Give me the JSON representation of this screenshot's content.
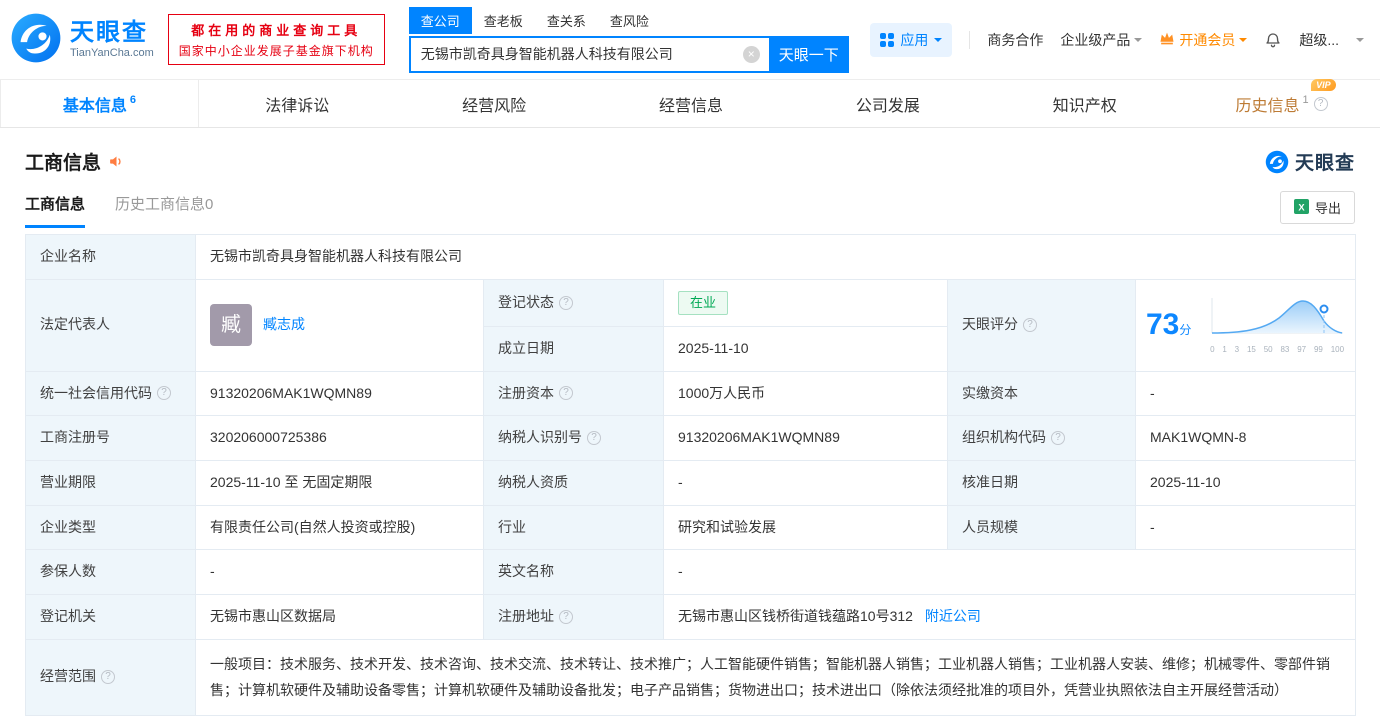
{
  "colors": {
    "brand_blue": "#0084ff",
    "promo_red": "#e60012",
    "status_green": "#00a854",
    "history_tab": "#bd7b35",
    "vip_orange": "#ff9a1f",
    "label_cell_bg": "#eef6fb"
  },
  "header": {
    "logo": {
      "name": "天眼查",
      "domain": "TianYanCha.com"
    },
    "promo": {
      "line1": "都在用的商业查询工具",
      "line2": "国家中小企业发展子基金旗下机构"
    },
    "search": {
      "tabs": [
        {
          "label": "查公司"
        },
        {
          "label": "查老板"
        },
        {
          "label": "查关系"
        },
        {
          "label": "查风险"
        }
      ],
      "value": "无锡市凯奇具身智能机器人科技有限公司",
      "button": "天眼一下"
    },
    "nav": {
      "app": "应用",
      "cooperation": "商务合作",
      "enterprise": "企业级产品",
      "member": "开通会员",
      "super": "超级..."
    }
  },
  "main_tabs": [
    {
      "label": "基本信息",
      "count": "6"
    },
    {
      "label": "法律诉讼"
    },
    {
      "label": "经营风险"
    },
    {
      "label": "经营信息"
    },
    {
      "label": "公司发展"
    },
    {
      "label": "知识产权"
    },
    {
      "label": "历史信息",
      "count": "1",
      "vip_label": "VIP"
    }
  ],
  "section": {
    "title": "工商信息",
    "brand": "天眼查",
    "tabs": [
      {
        "label": "工商信息"
      },
      {
        "label": "历史工商信息0"
      }
    ],
    "export": "导出"
  },
  "info": {
    "company_name": {
      "label": "企业名称",
      "value": "无锡市凯奇具身智能机器人科技有限公司"
    },
    "legal_rep": {
      "label": "法定代表人",
      "avatar": "臧",
      "name": "臧志成"
    },
    "reg_status": {
      "label": "登记状态",
      "value": "在业"
    },
    "est_date": {
      "label": "成立日期",
      "value": "2025-11-10"
    },
    "score": {
      "label": "天眼评分",
      "value": "73",
      "unit": "分",
      "axis": [
        "0",
        "1",
        "3",
        "15",
        "50",
        "83",
        "97",
        "99",
        "100"
      ]
    },
    "credit_code": {
      "label": "统一社会信用代码",
      "value": "91320206MAK1WQMN89"
    },
    "reg_capital": {
      "label": "注册资本",
      "value": "1000万人民币"
    },
    "paid_capital": {
      "label": "实缴资本",
      "value": "-"
    },
    "reg_number": {
      "label": "工商注册号",
      "value": "320206000725386"
    },
    "taxpayer_id": {
      "label": "纳税人识别号",
      "value": "91320206MAK1WQMN89"
    },
    "org_code": {
      "label": "组织机构代码",
      "value": "MAK1WQMN-8"
    },
    "term": {
      "label": "营业期限",
      "value": "2025-11-10 至 无固定期限"
    },
    "taxpayer_quality": {
      "label": "纳税人资质",
      "value": "-"
    },
    "approval_date": {
      "label": "核准日期",
      "value": "2025-11-10"
    },
    "company_type": {
      "label": "企业类型",
      "value": "有限责任公司(自然人投资或控股)"
    },
    "industry": {
      "label": "行业",
      "value": "研究和试验发展"
    },
    "staff_size": {
      "label": "人员规模",
      "value": "-"
    },
    "insured": {
      "label": "参保人数",
      "value": "-"
    },
    "english_name": {
      "label": "英文名称",
      "value": "-"
    },
    "authority": {
      "label": "登记机关",
      "value": "无锡市惠山区数据局"
    },
    "address": {
      "label": "注册地址",
      "value": "无锡市惠山区钱桥街道钱蕴路10号312",
      "link": "附近公司"
    },
    "scope": {
      "label": "经营范围",
      "value": "一般项目：技术服务、技术开发、技术咨询、技术交流、技术转让、技术推广；人工智能硬件销售；智能机器人销售；工业机器人销售；工业机器人安装、维修；机械零件、零部件销售；计算机软硬件及辅助设备零售；计算机软硬件及辅助设备批发；电子产品销售；货物进出口；技术进出口（除依法须经批准的项目外，凭营业执照依法自主开展经营活动）"
    }
  }
}
